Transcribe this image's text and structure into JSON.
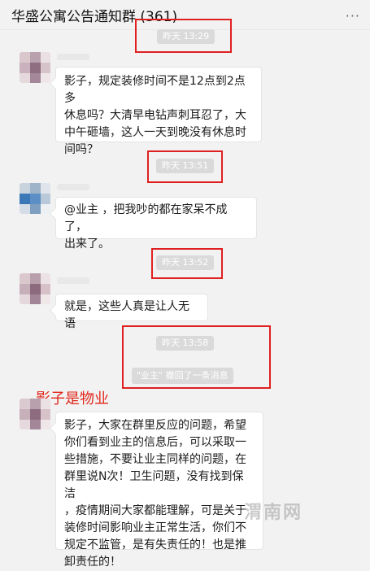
{
  "header": {
    "title": "华盛公寓公告通知群 (361)",
    "more_label": "···"
  },
  "messages": [
    {
      "timestamp": "昨天 13:29",
      "text": "影子，规定装修时间不是12点到2点多\n休息吗？大清早电钻声刺耳忍了，大\n中午砸墙，这人一天到晚没有休息时\n间吗？"
    },
    {
      "timestamp": "昨天 13:51",
      "text": "@业主 ，把我吵的都在家呆不成了，\n出来了。"
    },
    {
      "timestamp": "昨天 13:52",
      "text": "就是，这些人真是让人无语"
    },
    {
      "timestamp": "昨天 13:58",
      "recall_notice": "\"业主\" 撤回了一条消息"
    },
    {
      "annotation": "影子是物业",
      "text": "影子，大家在群里反应的问题，希望\n你们看到业主的信息后，可以采取一\n些措施，不要让业主同样的问题，在\n群里说N次！卫生问题，没有找到保洁\n，疫情期间大家都能理解，可是关于\n装修时间影响业主正常生活，你们不\n规定不监管，是有失责任的！也是推\n卸责任的！"
    }
  ],
  "watermark": "渭南网",
  "colors": {
    "annotation_red": "#e0271a",
    "highlight_box": "#e02020",
    "timestamp_bg": "#dadada"
  }
}
